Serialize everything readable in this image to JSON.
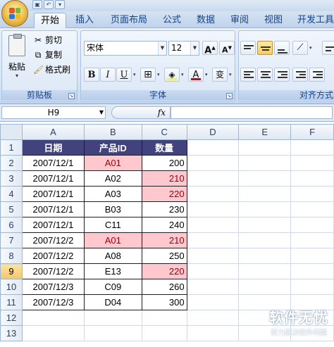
{
  "ribbon": {
    "tabs": [
      "开始",
      "插入",
      "页面布局",
      "公式",
      "数据",
      "审阅",
      "视图",
      "开发工具"
    ],
    "active_tab": "开始",
    "clipboard": {
      "paste_label": "粘贴",
      "cut_label": "剪切",
      "copy_label": "复制",
      "format_painter_label": "格式刷",
      "group_label": "剪贴板"
    },
    "font": {
      "font_name": "宋体",
      "font_size": "12",
      "grow_label": "A",
      "shrink_label": "A",
      "bold_label": "B",
      "italic_label": "I",
      "underline_label": "U",
      "font_color_label": "A",
      "phonetic_label": "变",
      "group_label": "字体"
    },
    "alignment": {
      "group_label": "对齐方式"
    }
  },
  "formula_bar": {
    "name_box": "H9",
    "fx_label": "fx",
    "formula": ""
  },
  "sheet": {
    "columns": [
      "A",
      "B",
      "C",
      "D",
      "E",
      "F"
    ],
    "header_row": [
      "日期",
      "产品ID",
      "数量"
    ],
    "rows": [
      {
        "num": "2",
        "date": "2007/12/1",
        "id": "A01",
        "qty": "200"
      },
      {
        "num": "3",
        "date": "2007/12/1",
        "id": "A02",
        "qty": "210"
      },
      {
        "num": "4",
        "date": "2007/12/1",
        "id": "A03",
        "qty": "220"
      },
      {
        "num": "5",
        "date": "2007/12/1",
        "id": "B03",
        "qty": "230"
      },
      {
        "num": "6",
        "date": "2007/12/1",
        "id": "C11",
        "qty": "240"
      },
      {
        "num": "7",
        "date": "2007/12/2",
        "id": "A01",
        "qty": "210"
      },
      {
        "num": "8",
        "date": "2007/12/2",
        "id": "A08",
        "qty": "250"
      },
      {
        "num": "9",
        "date": "2007/12/2",
        "id": "E13",
        "qty": "220"
      },
      {
        "num": "10",
        "date": "2007/12/3",
        "id": "C09",
        "qty": "260"
      },
      {
        "num": "11",
        "date": "2007/12/3",
        "id": "D04",
        "qty": "300"
      }
    ],
    "row_numbers": [
      "1",
      "12",
      "13"
    ],
    "selected_row": "9",
    "highlight_color": "#ffc7ce",
    "highlight_text_color": "#9c0006",
    "header_fill": "#42427e"
  },
  "watermark": {
    "title": "软件无忧",
    "subtitle": "努力解决软件问题"
  }
}
